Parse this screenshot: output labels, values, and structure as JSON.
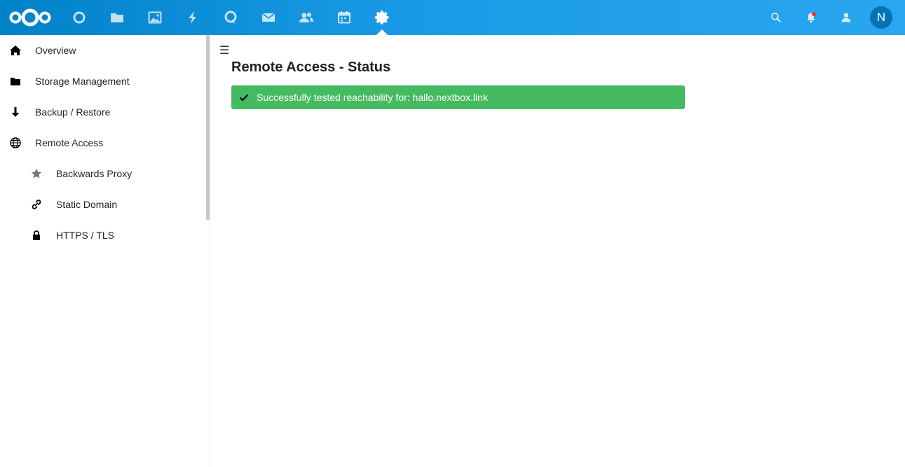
{
  "header": {
    "apps": [
      {
        "name": "dashboard-app-icon"
      },
      {
        "name": "files-app-icon"
      },
      {
        "name": "photos-app-icon"
      },
      {
        "name": "activity-app-icon"
      },
      {
        "name": "talk-app-icon"
      },
      {
        "name": "mail-app-icon"
      },
      {
        "name": "contacts-app-icon"
      },
      {
        "name": "calendar-app-icon"
      },
      {
        "name": "settings-app-icon",
        "active": true
      }
    ],
    "avatar_initial": "N",
    "colors": {
      "bar": "#0082c9",
      "active_caret": "#ffffff",
      "notification_dot": "#e9322d",
      "avatar": "#0073b8"
    }
  },
  "sidebar": {
    "items": [
      {
        "label": "Overview",
        "icon": "home-icon"
      },
      {
        "label": "Storage Management",
        "icon": "folder-icon"
      },
      {
        "label": "Backup / Restore",
        "icon": "arrow-down-icon"
      },
      {
        "label": "Remote Access",
        "icon": "globe-icon"
      },
      {
        "label": "Backwards Proxy",
        "icon": "star-icon",
        "sub": true
      },
      {
        "label": "Static Domain",
        "icon": "link-icon",
        "sub": true
      },
      {
        "label": "HTTPS / TLS",
        "icon": "lock-icon",
        "sub": true
      }
    ]
  },
  "main": {
    "title": "Remote Access - Status",
    "alert": {
      "message": "Successfully tested reachability for: hallo.nextbox.link",
      "type": "success",
      "color": "#46ba61"
    }
  }
}
